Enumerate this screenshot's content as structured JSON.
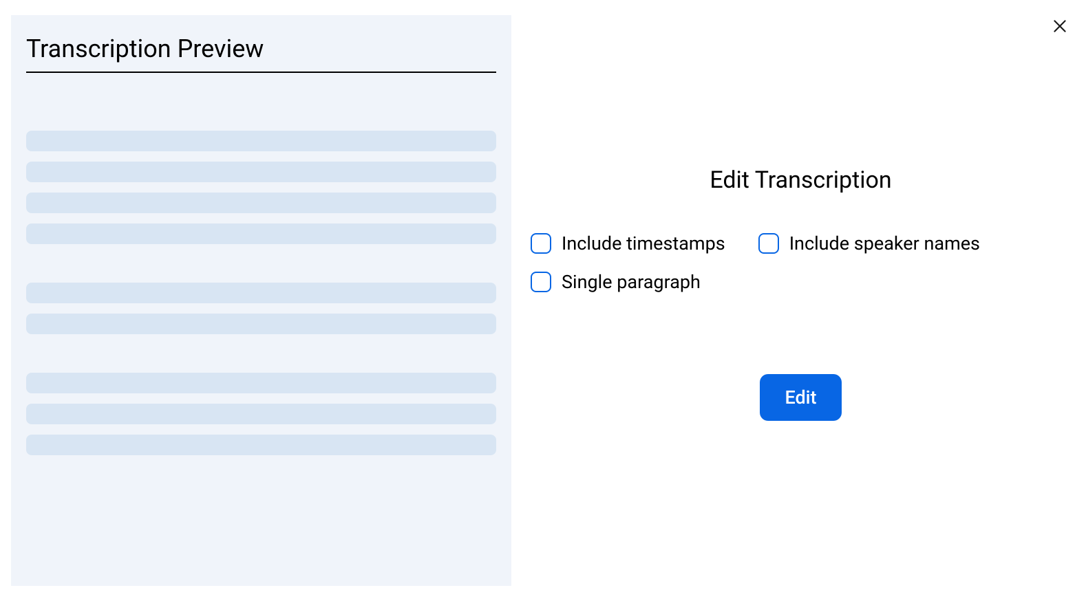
{
  "preview": {
    "title": "Transcription Preview"
  },
  "editor": {
    "title": "Edit Transcription",
    "options": {
      "include_timestamps": "Include timestamps",
      "include_speaker_names": "Include speaker names",
      "single_paragraph": "Single paragraph"
    },
    "button_label": "Edit"
  },
  "colors": {
    "accent": "#0866e4",
    "panel_bg": "#f0f4fa",
    "skeleton": "#d8e5f3"
  },
  "skeleton_layout": {
    "blocks": [
      4,
      2,
      3
    ]
  }
}
